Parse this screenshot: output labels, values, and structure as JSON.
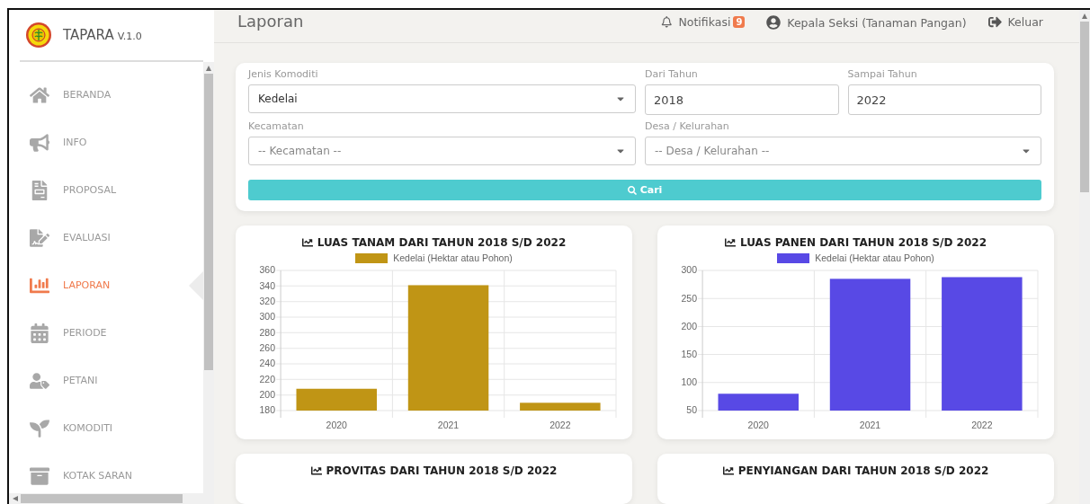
{
  "app": {
    "name": "TAPARA",
    "version": "V.1.0"
  },
  "sidebar": {
    "items": [
      {
        "label": "BERANDA",
        "selected": false
      },
      {
        "label": "INFO",
        "selected": false
      },
      {
        "label": "PROPOSAL",
        "selected": false
      },
      {
        "label": "EVALUASI",
        "selected": false
      },
      {
        "label": "LAPORAN",
        "selected": true
      },
      {
        "label": "PERIODE",
        "selected": false
      },
      {
        "label": "PETANI",
        "selected": false
      },
      {
        "label": "KOMODITI",
        "selected": false
      },
      {
        "label": "KOTAK SARAN",
        "selected": false
      }
    ]
  },
  "header": {
    "title": "Laporan",
    "notification": {
      "label": "Notifikasi",
      "count": "9"
    },
    "user": "Kepala Seksi (Tanaman Pangan)",
    "logout": "Keluar"
  },
  "filter": {
    "fields": [
      {
        "kind": "select",
        "label": "Jenis Komoditi",
        "value": "Kedelai"
      },
      {
        "kind": "input",
        "label": "Dari Tahun",
        "value": "2018"
      },
      {
        "kind": "input",
        "label": "Sampai Tahun",
        "value": "2022"
      },
      {
        "kind": "select",
        "label": "Kecamatan",
        "placeholder": "-- Kecamatan --"
      },
      {
        "kind": "select",
        "label": "Desa / Kelurahan",
        "placeholder": "-- Desa / Kelurahan --"
      }
    ],
    "button": "Cari"
  },
  "charts": [
    {
      "chart_data": {
        "type": "bar",
        "title": "LUAS TANAM DARI TAHUN 2018 S/D 2022",
        "categories": [
          "2020",
          "2021",
          "2022"
        ],
        "series": [
          {
            "name": "Kedelai (Hektar atau Pohon)",
            "color": "#c09515",
            "values": [
              208,
              341,
              190
            ]
          }
        ],
        "ylim": [
          180,
          360
        ],
        "grid": true,
        "yticks": [
          180,
          200,
          220,
          240,
          260,
          280,
          300,
          320,
          340,
          360
        ]
      }
    },
    {
      "chart_data": {
        "type": "bar",
        "title": "LUAS PANEN DARI TAHUN 2018 S/D 2022",
        "categories": [
          "2020",
          "2021",
          "2022"
        ],
        "series": [
          {
            "name": "Kedelai (Hektar atau Pohon)",
            "color": "#5849e5",
            "values": [
              80,
              285,
              288
            ]
          }
        ],
        "ylim": [
          50,
          300
        ],
        "grid": true,
        "yticks": [
          50,
          100,
          150,
          200,
          250,
          300
        ]
      }
    }
  ],
  "more_charts": [
    {
      "title": "PROVITAS DARI TAHUN 2018 S/D 2022"
    },
    {
      "title": "PENYIANGAN DARI TAHUN 2018 S/D 2022"
    }
  ]
}
